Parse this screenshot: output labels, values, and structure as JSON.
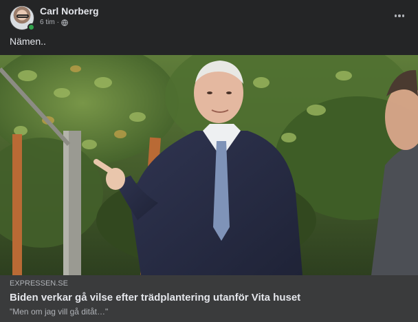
{
  "post": {
    "author": "Carl Norberg",
    "time": "6 tim",
    "separator": "·",
    "privacy_icon": "globe-icon",
    "more_icon": "more-options-icon",
    "text": "Nämen.."
  },
  "link": {
    "domain": "EXPRESSEN.SE",
    "headline": "Biden verkar gå vilse efter trädplantering utanför Vita huset",
    "subtitle": "\"Men om jag vill gå ditåt…\""
  },
  "colors": {
    "background": "#242526",
    "preview_background": "#3a3b3c",
    "primary_text": "#e4e6eb",
    "secondary_text": "#b0b3b8",
    "online_indicator": "#31a24c"
  }
}
